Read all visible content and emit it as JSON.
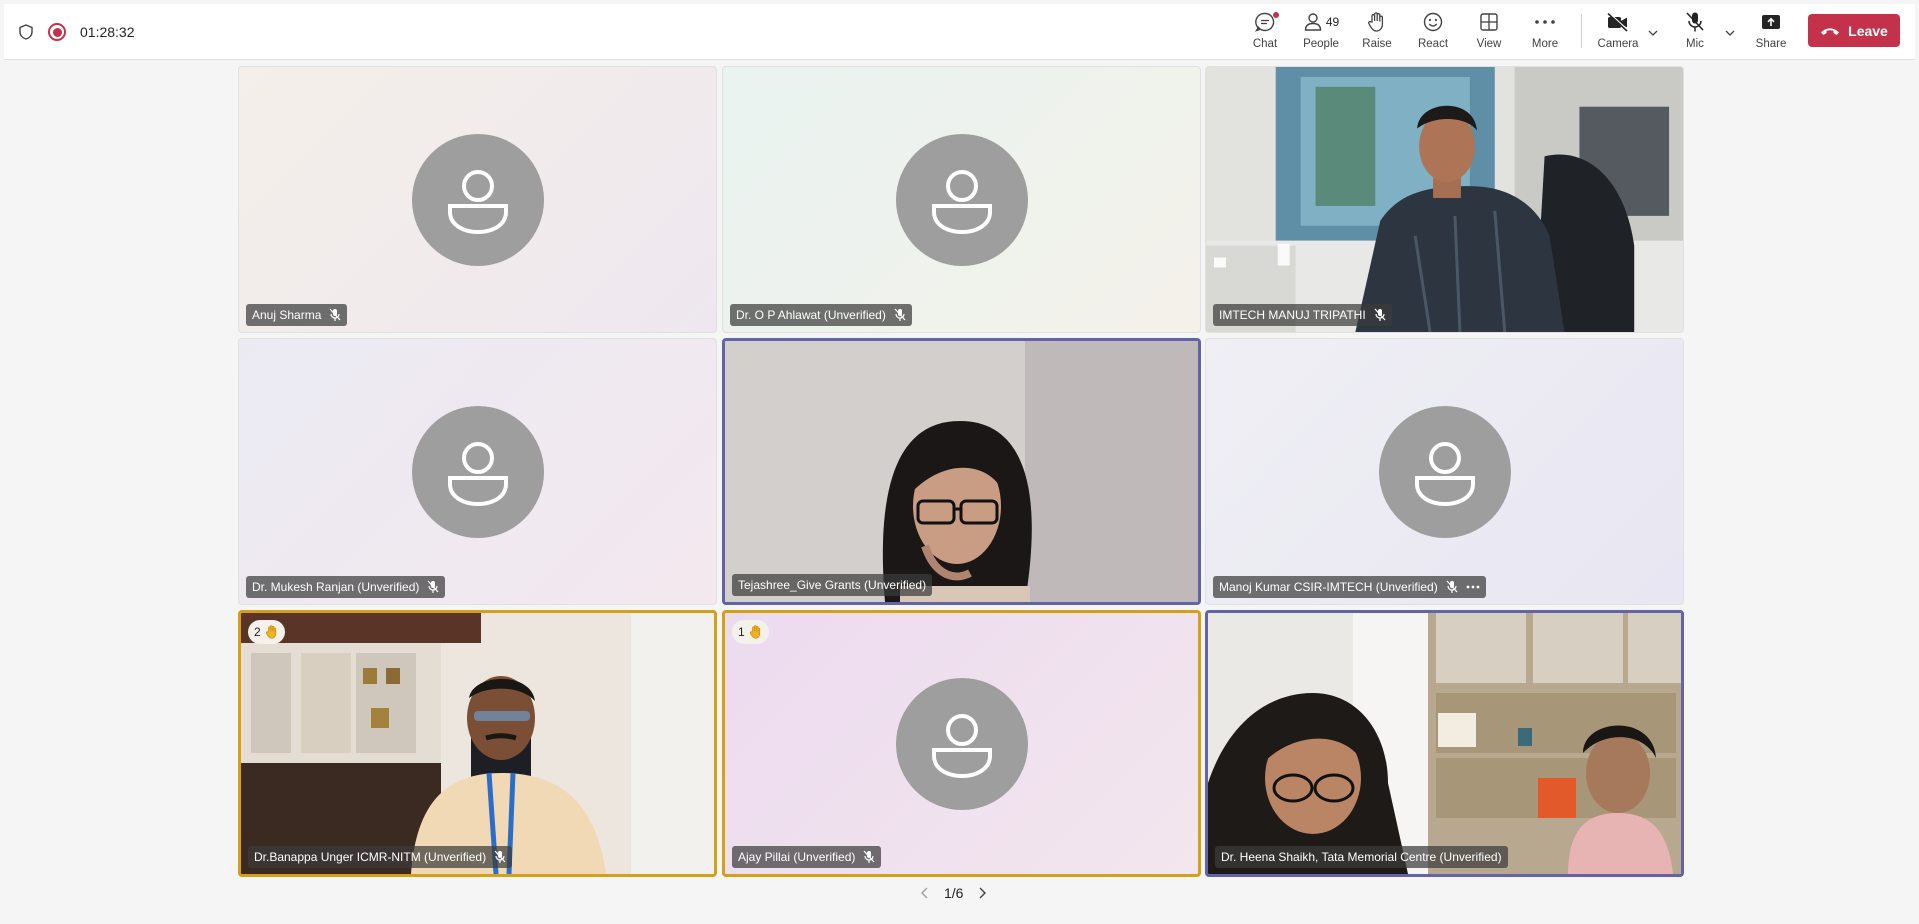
{
  "topbar": {
    "timer": "01:28:32",
    "chat_label": "Chat",
    "people_label": "People",
    "people_count": "49",
    "raise_label": "Raise",
    "react_label": "React",
    "view_label": "View",
    "more_label": "More",
    "camera_label": "Camera",
    "mic_label": "Mic",
    "share_label": "Share",
    "leave_label": "Leave"
  },
  "tiles": [
    {
      "name": "Anuj Sharma"
    },
    {
      "name": "Dr. O P Ahlawat (Unverified)"
    },
    {
      "name": "IMTECH MANUJ TRIPATHI"
    },
    {
      "name": "Dr. Mukesh Ranjan (Unverified)"
    },
    {
      "name": "Tejashree_Give Grants (Unverified)"
    },
    {
      "name": "Manoj Kumar CSIR-IMTECH (Unverified)"
    },
    {
      "name": "Dr.Banappa Unger ICMR-NITM (Unverified)",
      "hand_order": "2"
    },
    {
      "name": "Ajay Pillai (Unverified)",
      "hand_order": "1"
    },
    {
      "name": "Dr. Heena Shaikh, Tata Memorial Centre (Unverified)"
    }
  ],
  "pager": {
    "label": "1/6"
  },
  "colors": {
    "leave": "#c4314b",
    "selected_border": "#6264a7",
    "raised_border": "#d4a017",
    "recording": "#c4314b"
  }
}
